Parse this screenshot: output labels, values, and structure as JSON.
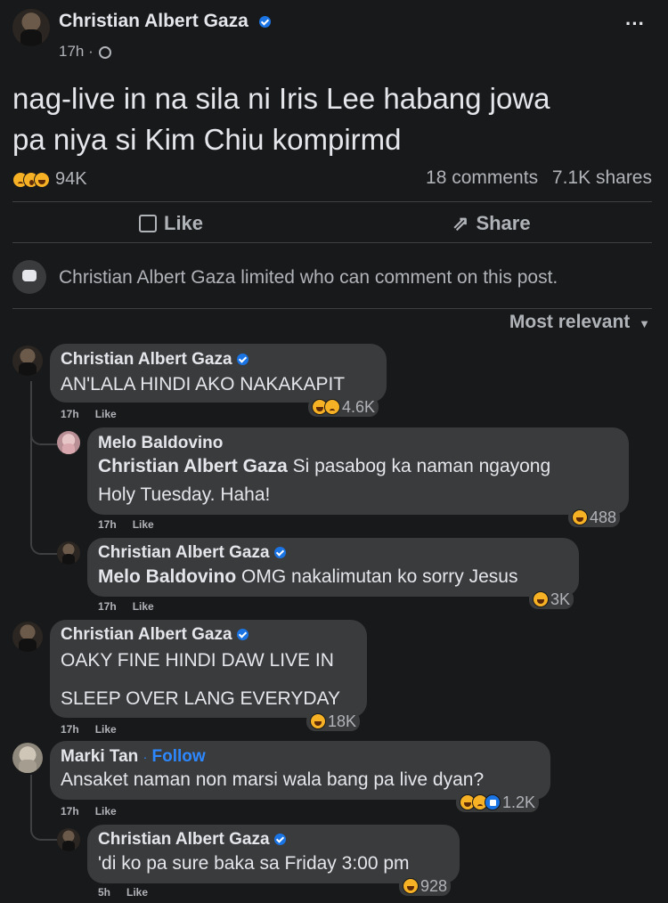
{
  "post": {
    "author": "Christian Albert Gaza",
    "time": "17h ·",
    "text_line1": "nag-live in na sila ni Iris Lee habang jowa",
    "text_line2": "pa niya si Kim Chiu kompirmd",
    "reaction_count": "94K",
    "comments_count": "18 comments",
    "shares_count": "7.1K shares",
    "more_label": "···"
  },
  "actions": {
    "like_label": "Like",
    "share_label": "Share"
  },
  "notice": "Christian Albert Gaza limited who can comment on this post.",
  "sort_label": "Most relevant",
  "comments": [
    {
      "author": "Christian Albert Gaza",
      "text": "AN'LALA HINDI AKO NAKAKAPIT",
      "time": "17h",
      "like": "Like",
      "reactions": "4.6K"
    },
    {
      "author": "Melo Baldovino",
      "mention": "Christian Albert Gaza",
      "text": " Si pasabog ka naman ngayong",
      "text2": "Holy Tuesday. Haha!",
      "time": "17h",
      "like": "Like",
      "reactions": "488"
    },
    {
      "author": "Christian Albert Gaza",
      "mention": "Melo Baldovino",
      "text": " OMG nakalimutan ko sorry Jesus",
      "time": "17h",
      "like": "Like",
      "reactions": "3K"
    },
    {
      "author": "Christian Albert Gaza",
      "text": "OAKY FINE HINDI DAW LIVE IN",
      "text2": "SLEEP OVER LANG EVERYDAY",
      "time": "17h",
      "like": "Like",
      "reactions": "18K"
    },
    {
      "author": "Marki Tan",
      "follow": "Follow",
      "text": "Ansaket naman non marsi wala bang pa live dyan?",
      "time": "17h",
      "like": "Like",
      "reactions": "1.2K"
    },
    {
      "author": "Christian Albert Gaza",
      "text": "'di ko pa sure baka sa Friday 3:00 pm",
      "time": "5h",
      "like": "Like",
      "reactions": "928"
    }
  ]
}
